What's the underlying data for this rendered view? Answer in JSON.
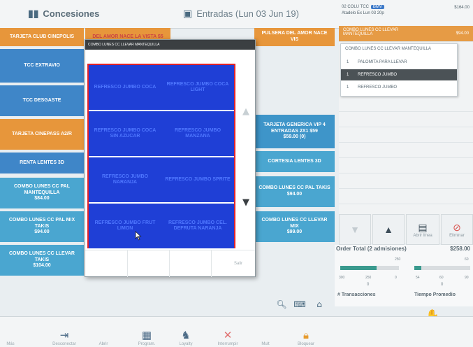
{
  "top": {
    "tab_left": "Concesiones",
    "tab_mid": "Entradas (Lun 03 Jun 19)",
    "order_head": "02 COLU TCC",
    "order_badge": "BMV",
    "order_sub": "Atadelo Ex Lun 03 20p",
    "order_amount": "$164.00"
  },
  "tiles": {
    "t1": "TARJETA CLUB CINEPOLIS",
    "t2": "DEL AMOR NACE LA VISTA $5",
    "t3": "PULSERA DEL AMOR NACE VIS",
    "t4": "TCC EXTRAVIO",
    "t5": "TCC DESGASTE",
    "t6": "TARJETA CINEPASS A2/R",
    "t7": "RENTA LENTES 3D",
    "t8_a": "COMBO LUNES CC PAL MANTEQUILLA",
    "t8_b": "$84.00",
    "t9_a": "COMBO LUNES CC PAL MIX TAKIS",
    "t9_b": "$94.00",
    "t10_a": "COMBO LUNES CC LLEVAR TAKIS",
    "t10_b": "$104.00",
    "t11_a": "TARJETA GENERICA VIP 4 ENTRADAS 2X1 $59",
    "t11_b": "$59.00 (0)",
    "t12": "CORTESIA LENTES 3D",
    "t13_a": "COMBO LUNES CC PAL TAKIS",
    "t13_b": "$94.00",
    "t14_a": "COMBO LUNES CC LLEVAR MIX",
    "t14_b": "$99.00"
  },
  "order_list": {
    "item_label": "COMBO LUNES CC LLEVAR MANTEQUILLA",
    "item_amount": "$94.00",
    "dropdown_title": "COMBO LUNES CC LLEVAR MANTEQUILLA",
    "rows": [
      {
        "num": "1",
        "label": "PALOMITA PARA LLEVAR"
      },
      {
        "num": "1",
        "label": "REFRESCO JUMBO"
      },
      {
        "num": "1",
        "label": "REFRESCO JUMBO"
      }
    ]
  },
  "actions": {
    "abrir": "Abrir línea",
    "eliminar": "Eliminar"
  },
  "totals": {
    "label": "Order Total (2 admisiones)",
    "value": "$258.00",
    "g1_mark": "250",
    "g2_mark": "60",
    "g1_lo": "300",
    "g1_mid": "250",
    "g1_hi": "0",
    "g1_val": "0",
    "g2_lo": "54",
    "g2_mid": "60",
    "g2_hi": "90",
    "g2_val": "0",
    "transacciones": "# Transacciones",
    "tiempo": "Tiempo Promedio",
    "g1_fill_pct": 0.62,
    "g2_fill_pct": 0.12
  },
  "modal": {
    "title": "COMBO LUNES CC LLEVAR MANTEQUILLA",
    "options": [
      "REFRESCO JUMBO COCA",
      "REFRESCO JUMBO COCA LIGHT",
      "REFRESCO JUMBO COCA SIN AZUCAR",
      "REFRESCO JUMBO MANZANA",
      "REFRESCO JUMBO NARANJA",
      "REFRESCO JUMBO SPRITE",
      "REFRESCO JUMBO FRUT LIMON",
      "REFRESCO JUMBO CEL. DEFRUTA NARANJA"
    ],
    "salir": "Salir"
  },
  "bottom": {
    "mas": "Más",
    "desconectar": "Desconectar",
    "abrir": "Abrir",
    "program": "Program.",
    "loyalty": "Loyalty",
    "interrumpir": "Interrumpir",
    "mult": "Mult",
    "bloquear": "Bloquear"
  },
  "colors": {
    "orange": "#e7963b",
    "blue": "#3f86c8",
    "option_blue": "#1f3fd6",
    "highlight_red": "#e0232a"
  }
}
